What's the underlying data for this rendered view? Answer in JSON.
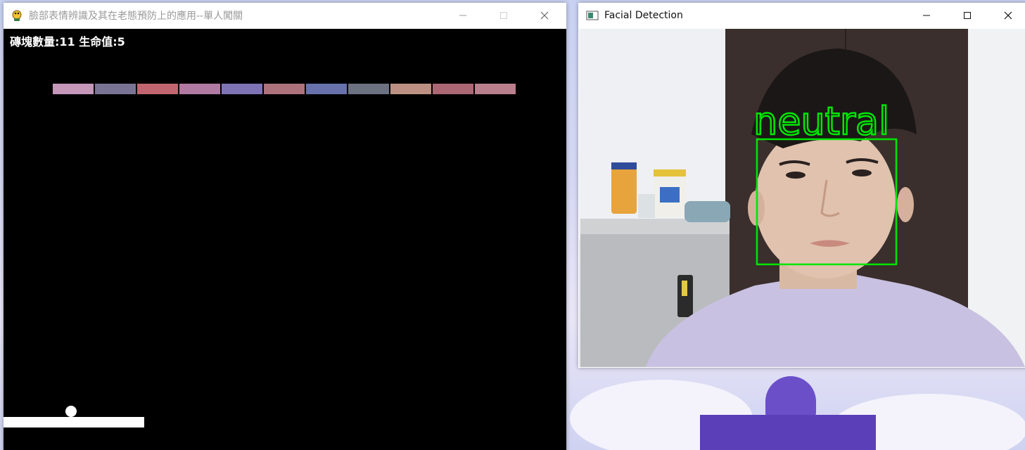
{
  "game_window": {
    "title": "臉部表情辨識及其在老態預防上的應用--單人闖關",
    "icon": "pygame-snake-icon",
    "hud": "磚塊數量:11 生命值:5",
    "bricks": [
      {
        "color": "#c597b9"
      },
      {
        "color": "#7a7494"
      },
      {
        "color": "#c16570"
      },
      {
        "color": "#b17aa2"
      },
      {
        "color": "#7e74b5"
      },
      {
        "color": "#ad727c"
      },
      {
        "color": "#6772ad"
      },
      {
        "color": "#6d7282"
      },
      {
        "color": "#bc9183"
      },
      {
        "color": "#ac6774"
      },
      {
        "color": "#b97f8d"
      }
    ]
  },
  "face_window": {
    "title": "Facial Detection",
    "icon": "opencv-window-icon",
    "emotion_label": "neutral",
    "box_color": "#00e600"
  }
}
